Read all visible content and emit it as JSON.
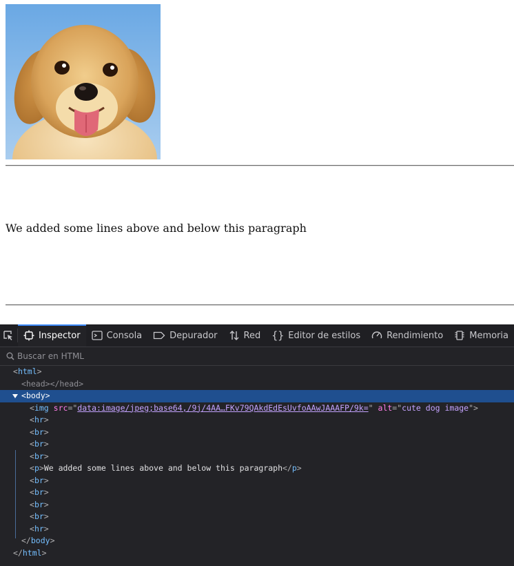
{
  "page": {
    "image_alt": "cute dog image",
    "paragraph": "We added some lines above and below this paragraph"
  },
  "devtools": {
    "tabs": [
      {
        "label": "Inspector",
        "icon": "inspector-icon",
        "active": true
      },
      {
        "label": "Consola",
        "icon": "console-icon"
      },
      {
        "label": "Depurador",
        "icon": "debugger-icon"
      },
      {
        "label": "Red",
        "icon": "network-icon"
      },
      {
        "label": "Editor de estilos",
        "icon": "style-editor-icon"
      },
      {
        "label": "Rendimiento",
        "icon": "performance-icon"
      },
      {
        "label": "Memoria",
        "icon": "memory-icon"
      }
    ],
    "search_placeholder": "Buscar en HTML",
    "accent_color": "#3d8bff",
    "tree": {
      "html_tag": "html",
      "head_tag": "head",
      "body_tag": "body",
      "img_tag": "img",
      "src_attr": "src",
      "src_value": "data:image/jpeg;base64,/9j/4AA…FKv79QAkdEdEsUvfoAAwJAAAFP/9k=",
      "alt_attr": "alt",
      "alt_value": "cute dog image",
      "hr_tag": "hr",
      "br_tag": "br",
      "p_tag": "p",
      "p_text": "We added some lines above and below this paragraph"
    }
  }
}
